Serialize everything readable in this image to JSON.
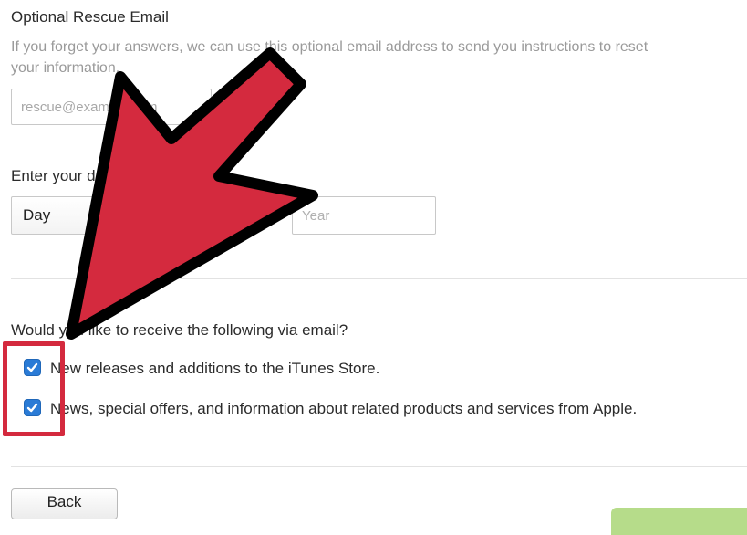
{
  "rescue_email": {
    "title": "Optional Rescue Email",
    "description_line1": "If you forget your answers, we can use this optional email address to send you instructions to reset",
    "description_line2": "your information.",
    "placeholder": "rescue@example.com"
  },
  "birthdate": {
    "label": "Enter your date of birth.",
    "day_value": "Day",
    "year_placeholder": "Year"
  },
  "email_prefs": {
    "question": "Would you like to receive the following via email?",
    "options": [
      {
        "label": "New releases and additions to the iTunes Store.",
        "checked": true
      },
      {
        "label": "News, special offers, and information about related products and services from Apple.",
        "checked": true
      }
    ]
  },
  "footer": {
    "back_label": "Back"
  },
  "colors": {
    "annotation_red": "#d42a3e",
    "checkbox_blue": "#2a7bd6",
    "continue_green": "#b6dc8a"
  }
}
